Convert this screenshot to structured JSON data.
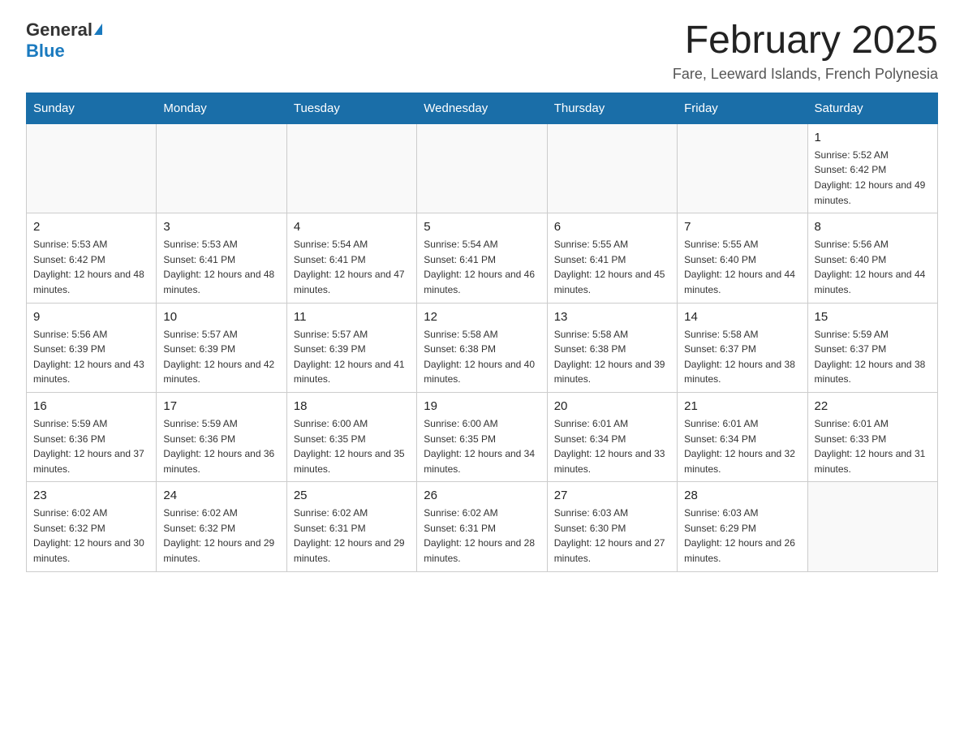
{
  "logo": {
    "general": "General",
    "blue": "Blue"
  },
  "title": "February 2025",
  "subtitle": "Fare, Leeward Islands, French Polynesia",
  "days_of_week": [
    "Sunday",
    "Monday",
    "Tuesday",
    "Wednesday",
    "Thursday",
    "Friday",
    "Saturday"
  ],
  "weeks": [
    [
      {
        "day": "",
        "info": ""
      },
      {
        "day": "",
        "info": ""
      },
      {
        "day": "",
        "info": ""
      },
      {
        "day": "",
        "info": ""
      },
      {
        "day": "",
        "info": ""
      },
      {
        "day": "",
        "info": ""
      },
      {
        "day": "1",
        "info": "Sunrise: 5:52 AM\nSunset: 6:42 PM\nDaylight: 12 hours and 49 minutes."
      }
    ],
    [
      {
        "day": "2",
        "info": "Sunrise: 5:53 AM\nSunset: 6:42 PM\nDaylight: 12 hours and 48 minutes."
      },
      {
        "day": "3",
        "info": "Sunrise: 5:53 AM\nSunset: 6:41 PM\nDaylight: 12 hours and 48 minutes."
      },
      {
        "day": "4",
        "info": "Sunrise: 5:54 AM\nSunset: 6:41 PM\nDaylight: 12 hours and 47 minutes."
      },
      {
        "day": "5",
        "info": "Sunrise: 5:54 AM\nSunset: 6:41 PM\nDaylight: 12 hours and 46 minutes."
      },
      {
        "day": "6",
        "info": "Sunrise: 5:55 AM\nSunset: 6:41 PM\nDaylight: 12 hours and 45 minutes."
      },
      {
        "day": "7",
        "info": "Sunrise: 5:55 AM\nSunset: 6:40 PM\nDaylight: 12 hours and 44 minutes."
      },
      {
        "day": "8",
        "info": "Sunrise: 5:56 AM\nSunset: 6:40 PM\nDaylight: 12 hours and 44 minutes."
      }
    ],
    [
      {
        "day": "9",
        "info": "Sunrise: 5:56 AM\nSunset: 6:39 PM\nDaylight: 12 hours and 43 minutes."
      },
      {
        "day": "10",
        "info": "Sunrise: 5:57 AM\nSunset: 6:39 PM\nDaylight: 12 hours and 42 minutes."
      },
      {
        "day": "11",
        "info": "Sunrise: 5:57 AM\nSunset: 6:39 PM\nDaylight: 12 hours and 41 minutes."
      },
      {
        "day": "12",
        "info": "Sunrise: 5:58 AM\nSunset: 6:38 PM\nDaylight: 12 hours and 40 minutes."
      },
      {
        "day": "13",
        "info": "Sunrise: 5:58 AM\nSunset: 6:38 PM\nDaylight: 12 hours and 39 minutes."
      },
      {
        "day": "14",
        "info": "Sunrise: 5:58 AM\nSunset: 6:37 PM\nDaylight: 12 hours and 38 minutes."
      },
      {
        "day": "15",
        "info": "Sunrise: 5:59 AM\nSunset: 6:37 PM\nDaylight: 12 hours and 38 minutes."
      }
    ],
    [
      {
        "day": "16",
        "info": "Sunrise: 5:59 AM\nSunset: 6:36 PM\nDaylight: 12 hours and 37 minutes."
      },
      {
        "day": "17",
        "info": "Sunrise: 5:59 AM\nSunset: 6:36 PM\nDaylight: 12 hours and 36 minutes."
      },
      {
        "day": "18",
        "info": "Sunrise: 6:00 AM\nSunset: 6:35 PM\nDaylight: 12 hours and 35 minutes."
      },
      {
        "day": "19",
        "info": "Sunrise: 6:00 AM\nSunset: 6:35 PM\nDaylight: 12 hours and 34 minutes."
      },
      {
        "day": "20",
        "info": "Sunrise: 6:01 AM\nSunset: 6:34 PM\nDaylight: 12 hours and 33 minutes."
      },
      {
        "day": "21",
        "info": "Sunrise: 6:01 AM\nSunset: 6:34 PM\nDaylight: 12 hours and 32 minutes."
      },
      {
        "day": "22",
        "info": "Sunrise: 6:01 AM\nSunset: 6:33 PM\nDaylight: 12 hours and 31 minutes."
      }
    ],
    [
      {
        "day": "23",
        "info": "Sunrise: 6:02 AM\nSunset: 6:32 PM\nDaylight: 12 hours and 30 minutes."
      },
      {
        "day": "24",
        "info": "Sunrise: 6:02 AM\nSunset: 6:32 PM\nDaylight: 12 hours and 29 minutes."
      },
      {
        "day": "25",
        "info": "Sunrise: 6:02 AM\nSunset: 6:31 PM\nDaylight: 12 hours and 29 minutes."
      },
      {
        "day": "26",
        "info": "Sunrise: 6:02 AM\nSunset: 6:31 PM\nDaylight: 12 hours and 28 minutes."
      },
      {
        "day": "27",
        "info": "Sunrise: 6:03 AM\nSunset: 6:30 PM\nDaylight: 12 hours and 27 minutes."
      },
      {
        "day": "28",
        "info": "Sunrise: 6:03 AM\nSunset: 6:29 PM\nDaylight: 12 hours and 26 minutes."
      },
      {
        "day": "",
        "info": ""
      }
    ]
  ]
}
